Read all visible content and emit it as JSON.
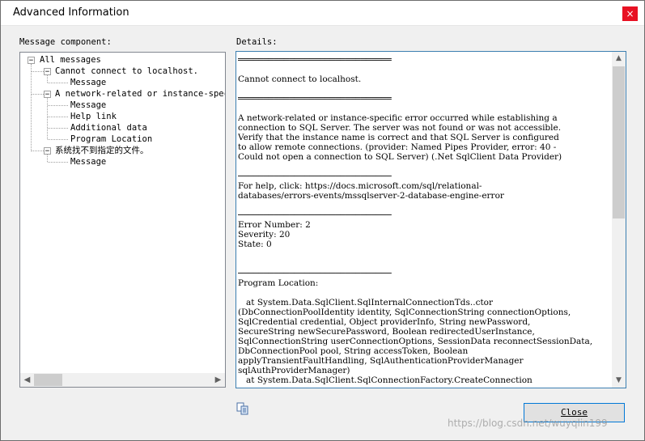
{
  "window": {
    "title": "Advanced Information",
    "close_glyph": "×"
  },
  "left_panel": {
    "label": "Message component:",
    "tree": [
      {
        "id": "all",
        "label": "All messages",
        "level": 0,
        "expander": "−"
      },
      {
        "id": "cannot",
        "label": "Cannot connect to localhost.",
        "level": 1,
        "expander": "−"
      },
      {
        "id": "cannot-msg",
        "label": "Message",
        "level": 2,
        "expander": ""
      },
      {
        "id": "network",
        "label": "A network-related or instance-specific error occurred while establishing a connection to SQL Server.",
        "level": 1,
        "expander": "−"
      },
      {
        "id": "network-msg",
        "label": "Message",
        "level": 2,
        "expander": ""
      },
      {
        "id": "network-help",
        "label": "Help link",
        "level": 2,
        "expander": ""
      },
      {
        "id": "network-data",
        "label": "Additional data",
        "level": 2,
        "expander": ""
      },
      {
        "id": "network-loc",
        "label": "Program Location",
        "level": 2,
        "expander": ""
      },
      {
        "id": "sys",
        "label": "系统找不到指定的文件。",
        "level": 1,
        "expander": "−"
      },
      {
        "id": "sys-msg",
        "label": "Message",
        "level": 2,
        "expander": ""
      }
    ]
  },
  "right_panel": {
    "label": "Details:",
    "lines": [
      "══════════════════════════════",
      "",
      "Cannot connect to localhost.",
      "",
      "══════════════════════════════",
      "",
      "A network-related or instance-specific error occurred while establishing a",
      "connection to SQL Server. The server was not found or was not accessible.",
      "Verify that the instance name is correct and that SQL Server is configured",
      "to allow remote connections. (provider: Named Pipes Provider, error: 40 -",
      "Could not open a connection to SQL Server) (.Net SqlClient Data Provider)",
      "",
      "──────────────────────────────",
      "For help, click: https://docs.microsoft.com/sql/relational-",
      "databases/errors-events/mssqlserver-2-database-engine-error",
      "",
      "──────────────────────────────",
      "Error Number: 2",
      "Severity: 20",
      "State: 0",
      "",
      "",
      "──────────────────────────────",
      "Program Location:",
      "",
      "   at System.Data.SqlClient.SqlInternalConnectionTds..ctor",
      "(DbConnectionPoolIdentity identity, SqlConnectionString connectionOptions,",
      "SqlCredential credential, Object providerInfo, String newPassword,",
      "SecureString newSecurePassword, Boolean redirectedUserInstance,",
      "SqlConnectionString userConnectionOptions, SessionData reconnectSessionData,",
      "DbConnectionPool pool, String accessToken, Boolean",
      "applyTransientFaultHandling, SqlAuthenticationProviderManager",
      "sqlAuthProviderManager)",
      "   at System.Data.SqlClient.SqlConnectionFactory.CreateConnection"
    ]
  },
  "footer": {
    "close_label": "Close",
    "watermark": "https://blog.csdn.net/wuyqlin199"
  },
  "icons": {
    "copy": "copy-icon",
    "close": "close-x-icon"
  },
  "colors": {
    "accent": "#0078d7",
    "close_red": "#e81123",
    "details_border": "#3c7fb1"
  }
}
